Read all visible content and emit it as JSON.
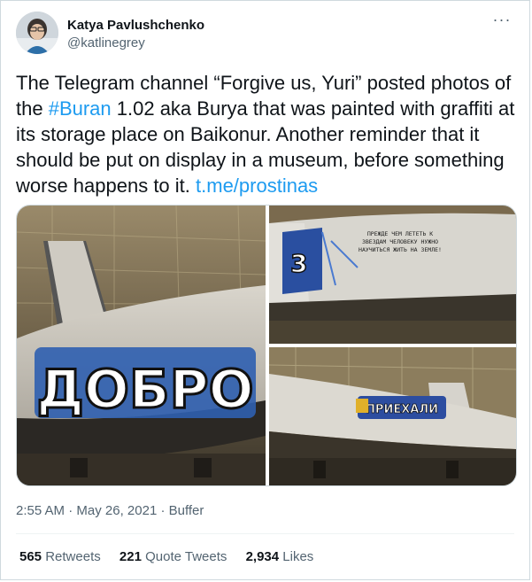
{
  "tweet": {
    "author": {
      "display_name": "Katya Pavlushchenko",
      "handle": "@katlinegrey"
    },
    "text": {
      "part1": "The Telegram channel “Forgive us, Yuri” posted photos of the ",
      "hashtag": "#Buran",
      "part2": " 1.02 aka Burya that was painted with graffiti at its storage place on Baikonur. Another reminder that it should be put on display in a museum, before something worse happens to it. ",
      "link": "t.me/prostinas"
    },
    "meta": {
      "time": "2:55 AM",
      "sep1": " · ",
      "date": "May 26, 2021",
      "sep2": " · ",
      "source": "Buffer"
    },
    "stats": {
      "retweets_count": "565",
      "retweets_label": "Retweets",
      "quotes_count": "221",
      "quotes_label": "Quote Tweets",
      "likes_count": "2,934",
      "likes_label": "Likes"
    }
  },
  "photos": {
    "photo1_graffiti": "ДОБРО",
    "photo2_graffiti": "ПРЕЖДЕ ЧЕМ ЛЕТЕТЬ К ЗВЕЗДАМ ЧЕЛОВЕКУ НУЖНО НАУЧИТЬСЯ ЖИТЬ НА ЗЕМЛЕ!",
    "photo3_graffiti": "ПРИЕХАЛИ"
  },
  "colors": {
    "link": "#1d9bf0",
    "secondary_text": "#536471",
    "primary_text": "#0f1419",
    "border": "#cfd9de"
  },
  "icons": {
    "more": "more-dots-icon"
  }
}
